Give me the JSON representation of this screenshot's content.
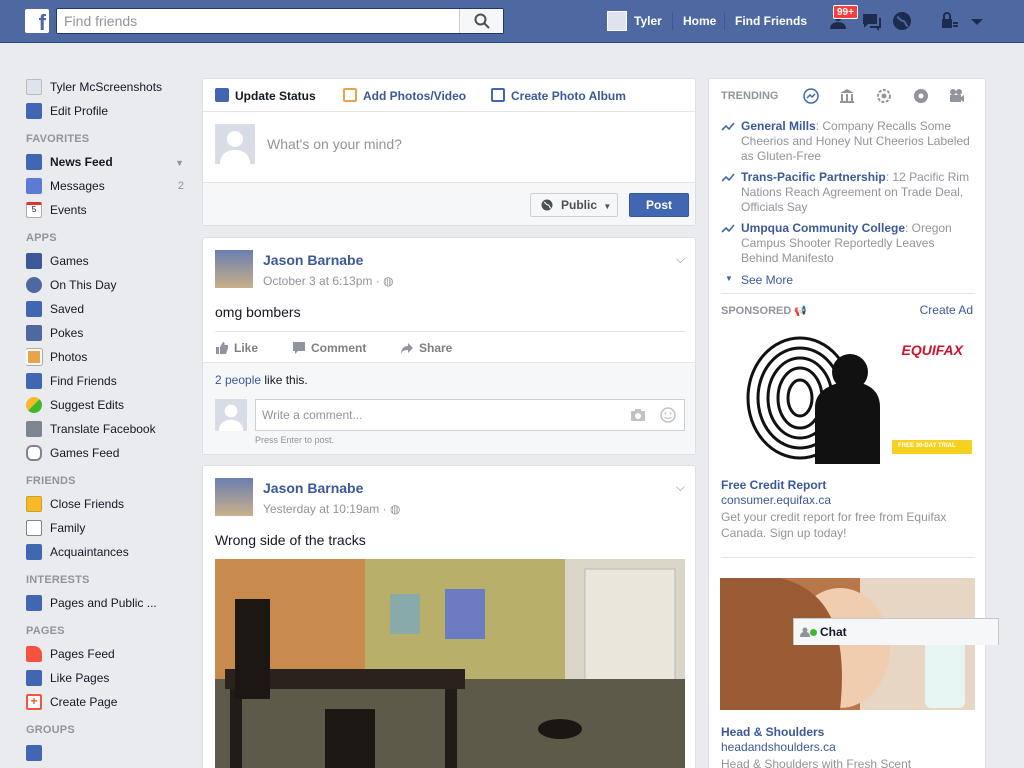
{
  "topbar": {
    "logo": "f",
    "search_placeholder": "Find friends",
    "user": "Tyler",
    "home": "Home",
    "find_friends": "Find Friends",
    "notification_badge": "99+"
  },
  "leftnav": {
    "profile_name": "Tyler McScreenshots",
    "edit_profile": "Edit Profile",
    "favorites_header": "FAVORITES",
    "favorites": [
      {
        "label": "News Feed",
        "count": ""
      },
      {
        "label": "Messages",
        "count": "2"
      },
      {
        "label": "Events",
        "count": ""
      }
    ],
    "apps_header": "APPS",
    "apps": [
      "Games",
      "On This Day",
      "Saved",
      "Pokes",
      "Photos",
      "Find Friends",
      "Suggest Edits",
      "Translate Facebook",
      "Games Feed"
    ],
    "friends_header": "FRIENDS",
    "friends": [
      "Close Friends",
      "Family",
      "Acquaintances"
    ],
    "interests_header": "INTERESTS",
    "interests": [
      "Pages and Public ..."
    ],
    "pages_header": "PAGES",
    "pages": [
      "Pages Feed",
      "Like Pages",
      "Create Page"
    ],
    "groups_header": "GROUPS"
  },
  "composer": {
    "tab_status": "Update Status",
    "tab_photos": "Add Photos/Video",
    "tab_album": "Create Photo Album",
    "placeholder": "What's on your mind?",
    "privacy": "Public",
    "post_button": "Post"
  },
  "posts": [
    {
      "author": "Jason Barnabe",
      "time": "October 3 at 6:13pm · ",
      "text": "omg bombers",
      "like": "Like",
      "comment": "Comment",
      "share": "Share",
      "likes_link": "2 people",
      "likes_rest": " like this.",
      "comment_placeholder": "Write a comment...",
      "comment_hint": "Press Enter to post."
    },
    {
      "author": "Jason Barnabe",
      "time": "Yesterday at 10:19am · ",
      "text": "Wrong side of the tracks"
    }
  ],
  "trending": {
    "header": "TRENDING",
    "items": [
      {
        "title": "General Mills",
        "desc": ": Company Recalls Some Cheerios and Honey Nut Cheerios Labeled as Gluten-Free"
      },
      {
        "title": "Trans-Pacific Partnership",
        "desc": ": 12 Pacific Rim Nations Reach Agreement on Trade Deal, Officials Say"
      },
      {
        "title": "Umpqua Community College",
        "desc": ": Oregon Campus Shooter Reportedly Leaves Behind Manifesto"
      }
    ],
    "see_more": "See More"
  },
  "sponsored": {
    "header": "SPONSORED",
    "create_ad": "Create Ad",
    "ads": [
      {
        "title": "Free Credit Report",
        "url": "consumer.equifax.ca",
        "desc": "Get your credit report for free from Equifax Canada. Sign up today!",
        "brand": "EQUIFAX",
        "badge": "FREE 30-DAY TRIAL"
      },
      {
        "title": "Head & Shoulders",
        "url": "headandshoulders.ca",
        "desc": "Head & Shoulders with Fresh Scent"
      }
    ]
  },
  "chat": {
    "label": "Chat"
  },
  "colors": {
    "brand": "#4e69a2",
    "link": "#3b5998",
    "post_button": "#4267b2",
    "online": "#42b72a",
    "badge": "#fa3e3e"
  }
}
